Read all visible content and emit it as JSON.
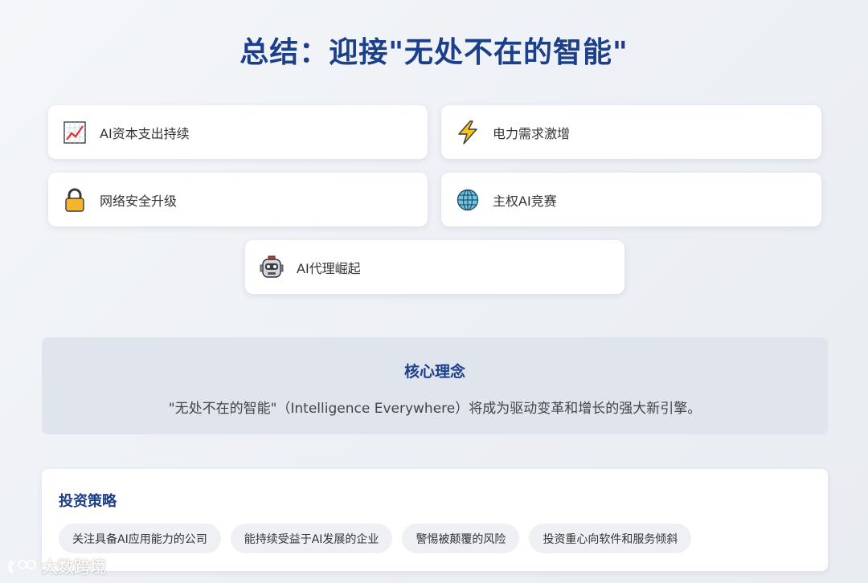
{
  "title": "总结：迎接\"无处不在的智能\"",
  "cards": [
    {
      "label": "AI资本支出持续",
      "icon": "chart-increasing-icon"
    },
    {
      "label": "电力需求激增",
      "icon": "lightning-icon"
    },
    {
      "label": "网络安全升级",
      "icon": "lock-icon"
    },
    {
      "label": "主权AI竞赛",
      "icon": "globe-icon"
    },
    {
      "label": "AI代理崛起",
      "icon": "robot-icon"
    }
  ],
  "core": {
    "title": "核心理念",
    "text": "\"无处不在的智能\"（Intelligence Everywhere）将成为驱动变革和增长的强大新引擎。"
  },
  "strategy": {
    "title": "投资策略",
    "chips": [
      "关注具备AI应用能力的公司",
      "能持续受益于AI发展的企业",
      "警惕被颠覆的风险",
      "投资重心向软件和服务倾斜"
    ]
  },
  "watermark": "大数跨境",
  "colors": {
    "accent": "#1c3f8c",
    "core_bg": "#dfe4ed",
    "chip_bg": "#eef0f4"
  }
}
